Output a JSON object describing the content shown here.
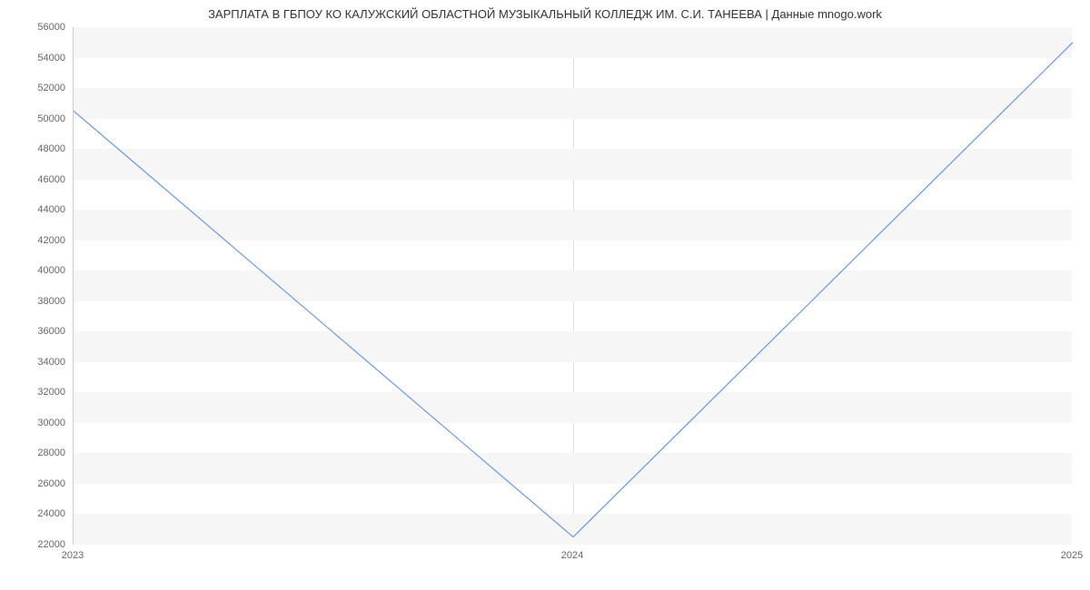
{
  "chart_data": {
    "type": "line",
    "title": "ЗАРПЛАТА В ГБПОУ КО КАЛУЖСКИЙ ОБЛАСТНОЙ МУЗЫКАЛЬНЫЙ КОЛЛЕДЖ ИМ. С.И. ТАНЕЕВА | Данные mnogo.work",
    "x": [
      2023,
      2024,
      2025
    ],
    "values": [
      50500,
      22500,
      55000
    ],
    "x_ticks": [
      2023,
      2024,
      2025
    ],
    "y_ticks": [
      22000,
      24000,
      26000,
      28000,
      30000,
      32000,
      34000,
      36000,
      38000,
      40000,
      42000,
      44000,
      46000,
      48000,
      50000,
      52000,
      54000,
      56000
    ],
    "xlim": [
      2023,
      2025
    ],
    "ylim": [
      22000,
      56000
    ],
    "xlabel": "",
    "ylabel": ""
  }
}
